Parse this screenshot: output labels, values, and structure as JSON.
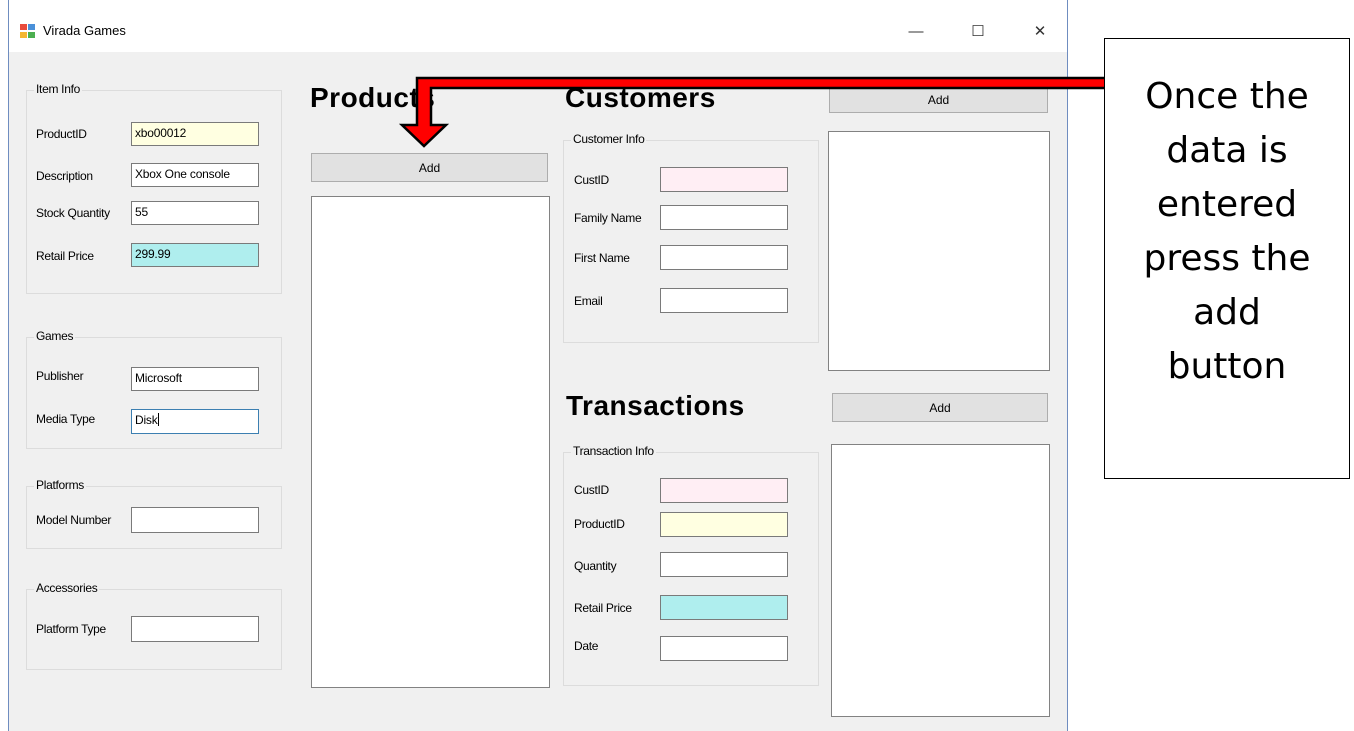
{
  "window": {
    "title": "Virada Games",
    "controls": [
      "—",
      "☐",
      "✕"
    ]
  },
  "item_info": {
    "title": "Item Info",
    "product_id": {
      "label": "ProductID",
      "value": "xbo00012"
    },
    "description": {
      "label": "Description",
      "value": "Xbox One console"
    },
    "stock_quantity": {
      "label": "Stock Quantity",
      "value": "55"
    },
    "retail_price": {
      "label": "Retail Price",
      "value": "299.99"
    }
  },
  "games": {
    "title": "Games",
    "publisher": {
      "label": "Publisher",
      "value": "Microsoft"
    },
    "media_type": {
      "label": "Media Type",
      "value": "Disk"
    }
  },
  "platforms": {
    "title": "Platforms",
    "model_number": {
      "label": "Model Number",
      "value": ""
    }
  },
  "accessories": {
    "title": "Accessories",
    "platform_type": {
      "label": "Platform Type",
      "value": ""
    }
  },
  "products": {
    "heading": "Products",
    "add_label": "Add"
  },
  "customers": {
    "heading": "Customers",
    "add_label": "Add",
    "group_title": "Customer Info",
    "cust_id": {
      "label": "CustID",
      "value": ""
    },
    "family_name": {
      "label": "Family Name",
      "value": ""
    },
    "first_name": {
      "label": "First Name",
      "value": ""
    },
    "email": {
      "label": "Email",
      "value": ""
    }
  },
  "transactions": {
    "heading": "Transactions",
    "add_label": "Add",
    "group_title": "Transaction Info",
    "cust_id": {
      "label": "CustID",
      "value": ""
    },
    "product_id": {
      "label": "ProductID",
      "value": ""
    },
    "quantity": {
      "label": "Quantity",
      "value": ""
    },
    "retail_price": {
      "label": "Retail Price",
      "value": ""
    },
    "date": {
      "label": "Date",
      "value": ""
    }
  },
  "callout": {
    "lines": [
      "Once the",
      "data is",
      "entered",
      "press the",
      "add",
      "button"
    ]
  },
  "colors": {
    "arrow_fill": "#ff0000",
    "field_yellow": "#ffffe1",
    "field_pink": "#ffeef4",
    "field_cyan": "#afeeee",
    "button_face": "#e1e1e1",
    "window_bg": "#f0f0f0"
  }
}
